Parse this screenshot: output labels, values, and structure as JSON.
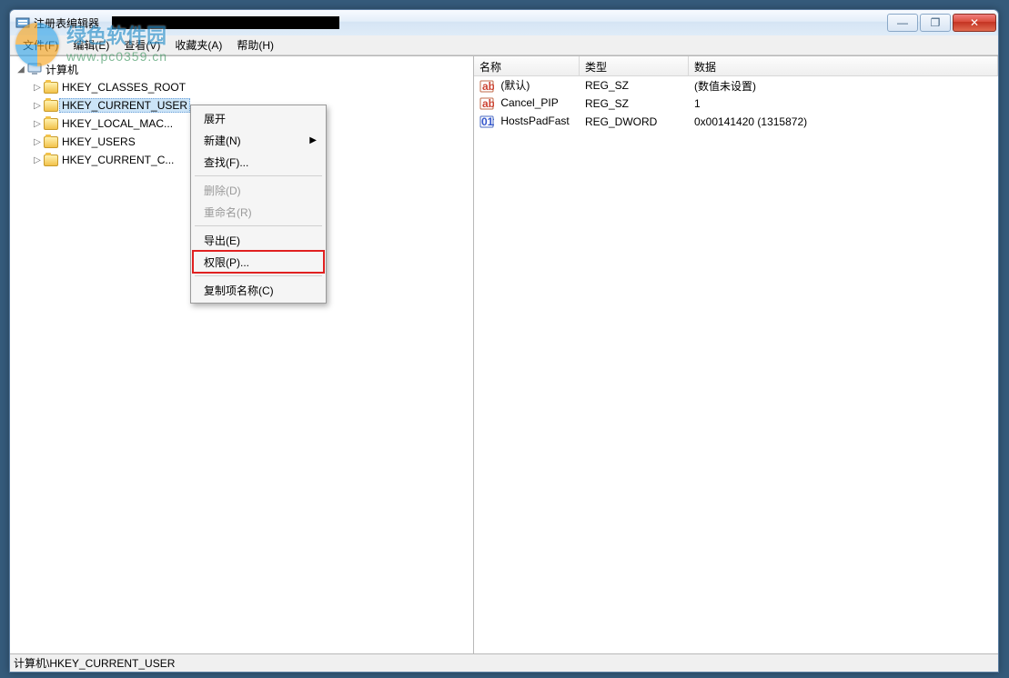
{
  "watermark": {
    "line1": "绿色软件园",
    "line2": "www.pc0359.cn"
  },
  "window": {
    "title": "注册表编辑器",
    "buttons": {
      "min": "—",
      "max": "❐",
      "close": "✕"
    }
  },
  "menubar": [
    {
      "id": "file",
      "label": "文件(F)"
    },
    {
      "id": "edit",
      "label": "编辑(E)"
    },
    {
      "id": "view",
      "label": "查看(V)"
    },
    {
      "id": "fav",
      "label": "收藏夹(A)"
    },
    {
      "id": "help",
      "label": "帮助(H)"
    }
  ],
  "tree": {
    "root": {
      "label": "计算机",
      "expanded": true
    },
    "items": [
      {
        "id": "hkcr",
        "label": "HKEY_CLASSES_ROOT"
      },
      {
        "id": "hkcu",
        "label": "HKEY_CURRENT_USER",
        "selected": true
      },
      {
        "id": "hklm",
        "label": "HKEY_LOCAL_MAC..."
      },
      {
        "id": "hku",
        "label": "HKEY_USERS"
      },
      {
        "id": "hkcc",
        "label": "HKEY_CURRENT_C..."
      }
    ]
  },
  "context_menu": [
    {
      "id": "expand",
      "label": "展开",
      "enabled": true
    },
    {
      "id": "new",
      "label": "新建(N)",
      "enabled": true,
      "submenu": true
    },
    {
      "id": "find",
      "label": "查找(F)...",
      "enabled": true
    },
    {
      "sep": true
    },
    {
      "id": "delete",
      "label": "删除(D)",
      "enabled": false
    },
    {
      "id": "rename",
      "label": "重命名(R)",
      "enabled": false
    },
    {
      "sep": true
    },
    {
      "id": "export",
      "label": "导出(E)",
      "enabled": true
    },
    {
      "id": "perm",
      "label": "权限(P)...",
      "enabled": true,
      "highlighted": true
    },
    {
      "sep": true
    },
    {
      "id": "copyname",
      "label": "复制项名称(C)",
      "enabled": true
    }
  ],
  "list": {
    "headers": {
      "name": "名称",
      "type": "类型",
      "data": "数据"
    },
    "rows": [
      {
        "icon": "sz",
        "name": "(默认)",
        "type": "REG_SZ",
        "data": "(数值未设置)"
      },
      {
        "icon": "sz",
        "name": "Cancel_PIP",
        "type": "REG_SZ",
        "data": "1"
      },
      {
        "icon": "dw",
        "name": "HostsPadFast",
        "type": "REG_DWORD",
        "data": "0x00141420 (1315872)"
      }
    ]
  },
  "statusbar": {
    "path": "计算机\\HKEY_CURRENT_USER"
  }
}
